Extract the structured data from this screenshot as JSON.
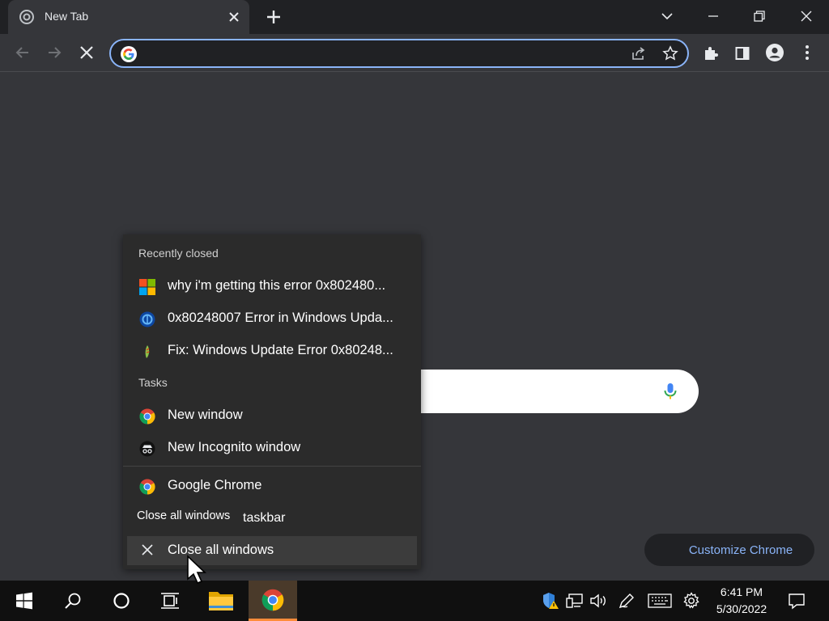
{
  "browser": {
    "tab_title": "New Tab",
    "omnibox_value": "",
    "customize_label": "Customize Chrome"
  },
  "jumplist": {
    "recent_header": "Recently closed",
    "recent_items": [
      {
        "label": "why i'm getting this error 0x802480...",
        "icon": "microsoft-icon"
      },
      {
        "label": "0x80248007 Error in Windows Upda...",
        "icon": "site-favicon-icon"
      },
      {
        "label": "Fix: Windows Update Error 0x80248...",
        "icon": "site-favicon-icon"
      }
    ],
    "tasks_header": "Tasks",
    "tasks": [
      {
        "label": "New window",
        "icon": "chrome-icon"
      },
      {
        "label": "New Incognito window",
        "icon": "incognito-icon"
      }
    ],
    "app_label": "Google Chrome",
    "tooltip_text": "Close all windows",
    "tooltip_text_2": "taskbar",
    "close_label": "Close all windows"
  },
  "taskbar": {
    "time": "6:41 PM",
    "date": "5/30/2022"
  },
  "colors": {
    "accent": "#8ab4f8",
    "chrome_active": "#ff8c3a"
  }
}
